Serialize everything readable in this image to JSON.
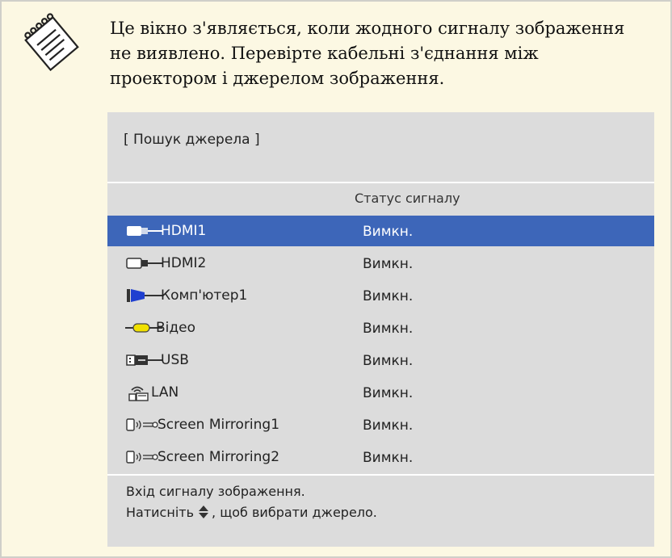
{
  "note": {
    "lines": [
      "Це вікно з'являється, коли жодного сигналу зображення",
      "не виявлено. Перевірте кабельні з'єднання між",
      "проектором і джерелом зображення."
    ]
  },
  "osd": {
    "title": "[ Пошук джерела ]",
    "column_header": "Статус сигналу",
    "sources": [
      {
        "label": "HDMI1",
        "status": "Вимкн.",
        "icon": "hdmi-plug-icon",
        "selected": true
      },
      {
        "label": "HDMI2",
        "status": "Вимкн.",
        "icon": "hdmi-plug-icon",
        "selected": false
      },
      {
        "label": "Комп'ютер1",
        "status": "Вимкн.",
        "icon": "vga-plug-icon",
        "selected": false
      },
      {
        "label": "Відео",
        "status": "Вимкн.",
        "icon": "rca-plug-icon",
        "selected": false
      },
      {
        "label": "USB",
        "status": "Вимкн.",
        "icon": "usb-plug-icon",
        "selected": false
      },
      {
        "label": "LAN",
        "status": "Вимкн.",
        "icon": "wireless-lan-icon",
        "selected": false
      },
      {
        "label": "Screen Mirroring1",
        "status": "Вимкн.",
        "icon": "screen-mirroring-icon",
        "selected": false
      },
      {
        "label": "Screen Mirroring2",
        "status": "Вимкн.",
        "icon": "screen-mirroring-icon",
        "selected": false
      }
    ],
    "footer_line1": "Вхід сигналу зображення.",
    "footer_line2_before": "Натисніть",
    "footer_line2_after": ", щоб вибрати джерело."
  },
  "colors": {
    "note_background": "#fcf8e3",
    "note_border": "#cfcfc9",
    "osd_background": "#dcdcdc",
    "selected_row": "#3d66b9"
  }
}
